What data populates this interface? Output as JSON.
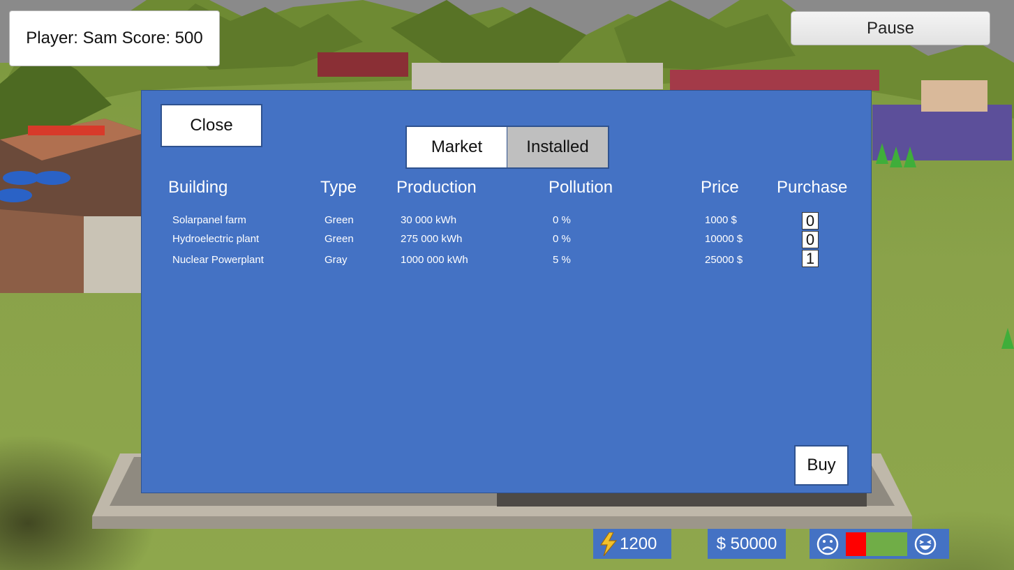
{
  "hud": {
    "player_score": "Player: Sam Score: 500",
    "pause_label": "Pause",
    "energy": "1200",
    "money": "$ 50000",
    "mood_negative_fraction": 0.33
  },
  "market": {
    "close_label": "Close",
    "tabs": [
      {
        "label": "Market",
        "active": true
      },
      {
        "label": "Installed",
        "active": false
      }
    ],
    "columns": [
      "Building",
      "Type",
      "Production",
      "Pollution",
      "Price",
      "Purchase"
    ],
    "rows": [
      {
        "building": "Solarpanel farm",
        "type": "Green",
        "production": "30 000 kWh",
        "pollution": "0 %",
        "price": "1000 $",
        "purchase": "0"
      },
      {
        "building": "Hydroelectric plant",
        "type": "Green",
        "production": "275 000 kWh",
        "pollution": "0 %",
        "price": "10000 $",
        "purchase": "0"
      },
      {
        "building": "Nuclear Powerplant",
        "type": "Gray",
        "production": "1000 000 kWh",
        "pollution": "5 %",
        "price": "25000 $",
        "purchase": "1"
      }
    ],
    "buy_label": "Buy"
  },
  "colors": {
    "panel": "#4472c4",
    "mood_negative": "#ff0000",
    "mood_positive": "#70ad47"
  },
  "icons": {
    "energy": "lightning-bolt-icon",
    "sad": "sad-face-icon",
    "happy": "laughing-face-icon"
  }
}
